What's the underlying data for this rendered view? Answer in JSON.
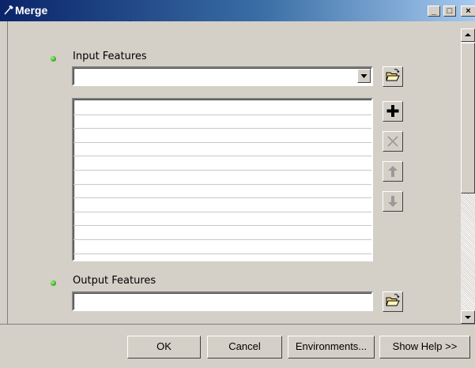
{
  "window": {
    "title": "Merge",
    "icon": "hammer-icon"
  },
  "title_buttons": {
    "minimize": "_",
    "maximize": "□",
    "close": "×"
  },
  "input_features": {
    "label": "Input Features",
    "value": ""
  },
  "output_features": {
    "label": "Output Features",
    "value": ""
  },
  "list_rows": [
    "",
    "",
    "",
    "",
    "",
    "",
    "",
    "",
    "",
    "",
    "",
    ""
  ],
  "tools": {
    "add": "plus-icon",
    "remove": "x-icon",
    "up": "arrow-up-icon",
    "down": "arrow-down-icon"
  },
  "buttons": {
    "ok": "OK",
    "cancel": "Cancel",
    "environments": "Environments...",
    "show_help": "Show Help >>"
  },
  "colors": {
    "titlebar_start": "#0a246a",
    "titlebar_end": "#a6caf0",
    "bullet": "#32b432",
    "face": "#d4d0c8"
  }
}
